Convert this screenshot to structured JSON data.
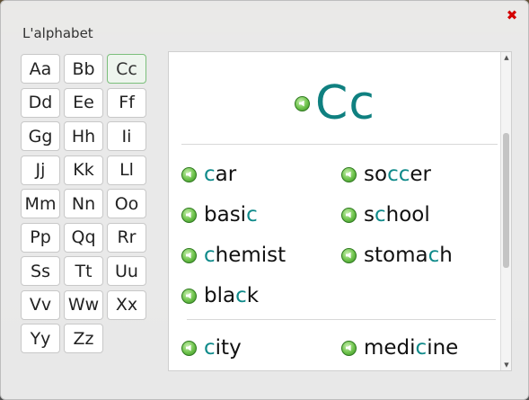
{
  "dialog": {
    "title": "L'alphabet",
    "close_symbol": "✖"
  },
  "letters": [
    "Aa",
    "Bb",
    "Cc",
    "Dd",
    "Ee",
    "Ff",
    "Gg",
    "Hh",
    "Ii",
    "Jj",
    "Kk",
    "Ll",
    "Mm",
    "Nn",
    "Oo",
    "Pp",
    "Qq",
    "Rr",
    "Ss",
    "Tt",
    "Uu",
    "Vv",
    "Ww",
    "Xx",
    "Yy",
    "Zz"
  ],
  "selected_letter": "Cc",
  "panel": {
    "headline": "Cc",
    "words": [
      {
        "pre": "",
        "hl": "c",
        "post": "ar"
      },
      {
        "pre": "so",
        "hl": "cc",
        "post": "er"
      },
      {
        "pre": "basi",
        "hl": "c",
        "post": ""
      },
      {
        "pre": "s",
        "hl": "c",
        "post": "hool"
      },
      {
        "pre": "",
        "hl": "c",
        "post": "hemist"
      },
      {
        "pre": "stoma",
        "hl": "c",
        "post": "h"
      },
      {
        "pre": "bla",
        "hl": "c",
        "post": "k"
      },
      {
        "pre": "",
        "hl": "c",
        "post": "ity"
      },
      {
        "pre": "medi",
        "hl": "c",
        "post": "ine"
      }
    ],
    "icons": {
      "speaker": "speaker-icon"
    },
    "accent_color": "#0f8a8a"
  },
  "scrollbar": {
    "up": "▲",
    "down": "▼"
  }
}
